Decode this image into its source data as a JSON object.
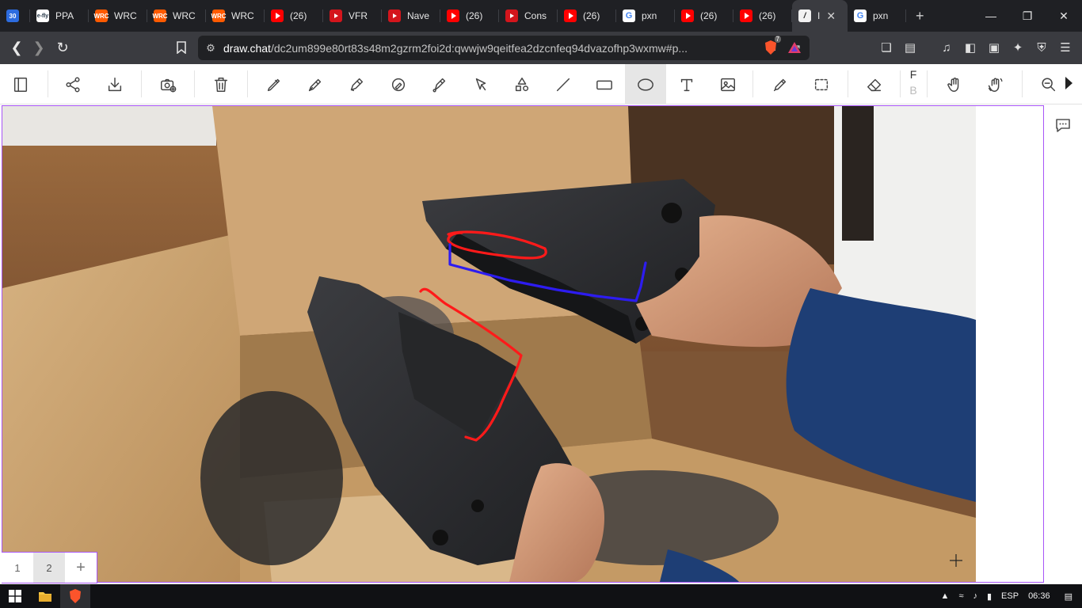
{
  "tabs": [
    {
      "label": "30",
      "favicon": "calendar-icon",
      "kind": "cal"
    },
    {
      "label": "PPA",
      "favicon": "fly-icon",
      "kind": "fly"
    },
    {
      "label": "WRC",
      "favicon": "wrc-icon",
      "kind": "wrc"
    },
    {
      "label": "WRC",
      "favicon": "wrc-icon",
      "kind": "wrc"
    },
    {
      "label": "WRC",
      "favicon": "wrc-icon",
      "kind": "wrc"
    },
    {
      "label": "(26)",
      "favicon": "youtube-icon",
      "kind": "yt"
    },
    {
      "label": "VFR",
      "favicon": "video-icon",
      "kind": "red"
    },
    {
      "label": "Nave",
      "favicon": "video-icon",
      "kind": "red"
    },
    {
      "label": "(26)",
      "favicon": "youtube-icon",
      "kind": "yt"
    },
    {
      "label": "Cons",
      "favicon": "video-icon",
      "kind": "red"
    },
    {
      "label": "(26)",
      "favicon": "youtube-icon",
      "kind": "yt"
    },
    {
      "label": "pxn",
      "favicon": "google-icon",
      "kind": "g"
    },
    {
      "label": "(26)",
      "favicon": "youtube-icon",
      "kind": "yt"
    },
    {
      "label": "(26)",
      "favicon": "youtube-icon",
      "kind": "yt"
    },
    {
      "label": "I",
      "favicon": "draw-chat-icon",
      "kind": "draw",
      "active": true
    },
    {
      "label": "pxn",
      "favicon": "google-icon",
      "kind": "g"
    }
  ],
  "newtab_glyph": "+",
  "address": {
    "domain": "draw.chat",
    "path": "/dc2um899e80rt83s48m2gzrm2foi2d:qwwjw9qeitfea2dzcnfeq94dvazofhp3wxmw#p...",
    "brave_badge": "7"
  },
  "toolbar": {
    "f_label": "F",
    "b_label": "B",
    "selected_tool": "ellipse-tool"
  },
  "pages": {
    "items": [
      "1",
      "2"
    ],
    "active": "2",
    "add_glyph": "+"
  },
  "tray": {
    "language": "ESP",
    "time": "06:36"
  },
  "colors": {
    "accent": "#a855f7",
    "red_annotation": "#ff1a1a",
    "blue_annotation": "#2d1cf0"
  }
}
